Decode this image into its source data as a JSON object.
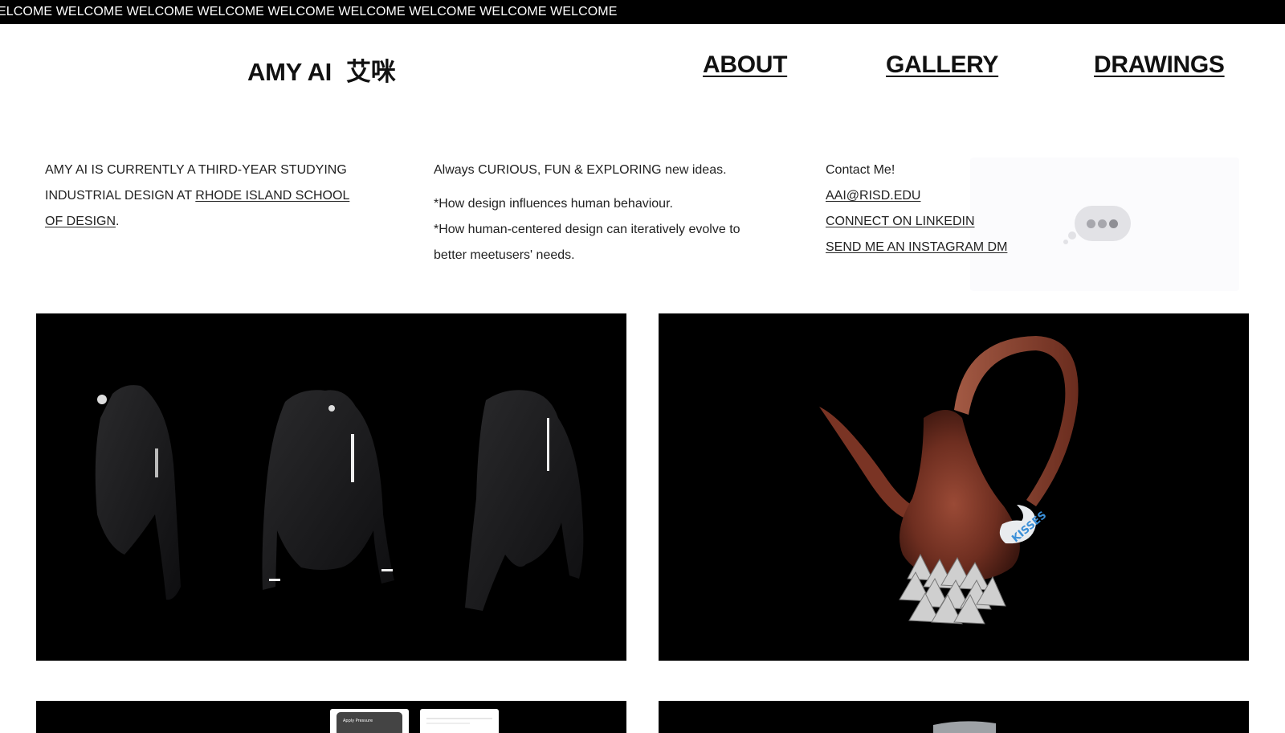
{
  "ticker": {
    "text": "ELCOME WELCOME WELCOME WELCOME WELCOME WELCOME WELCOME WELCOME WELCOME"
  },
  "brand": {
    "name": "AMY AI",
    "chinese": "艾咪"
  },
  "nav": {
    "about": "ABOUT",
    "gallery": "GALLERY",
    "drawings": "DRAWINGS"
  },
  "bio": {
    "text_before": "AMY AI IS CURRENTLY A THIRD-YEAR STUDYING INDUSTRIAL DESIGN AT ",
    "link": "RHODE ISLAND SCHOOL OF DESIGN",
    "text_after": "."
  },
  "interests": {
    "tagline": "Always CURIOUS, FUN & EXPLORING new ideas.",
    "line1": "*How design influences human behaviour.",
    "line2": "*How human-centered design can iteratively evolve to better meetusers' needs."
  },
  "contact": {
    "heading": "Contact Me!",
    "email": "AAI@RISD.EDU",
    "linkedin": "CONNECT ON LINKEDIN",
    "instagram": "SEND ME AN INSTAGRAM DM"
  },
  "gallery": {
    "kettle_label": "KISSES",
    "app_screen_title": "Apply Pressure"
  },
  "colors": {
    "ticker_bg": "#000000",
    "tile_bg": "#000000",
    "chat_bubble": "#e2e2e6"
  },
  "icons": {
    "chat": "typing-bubble-icon"
  }
}
